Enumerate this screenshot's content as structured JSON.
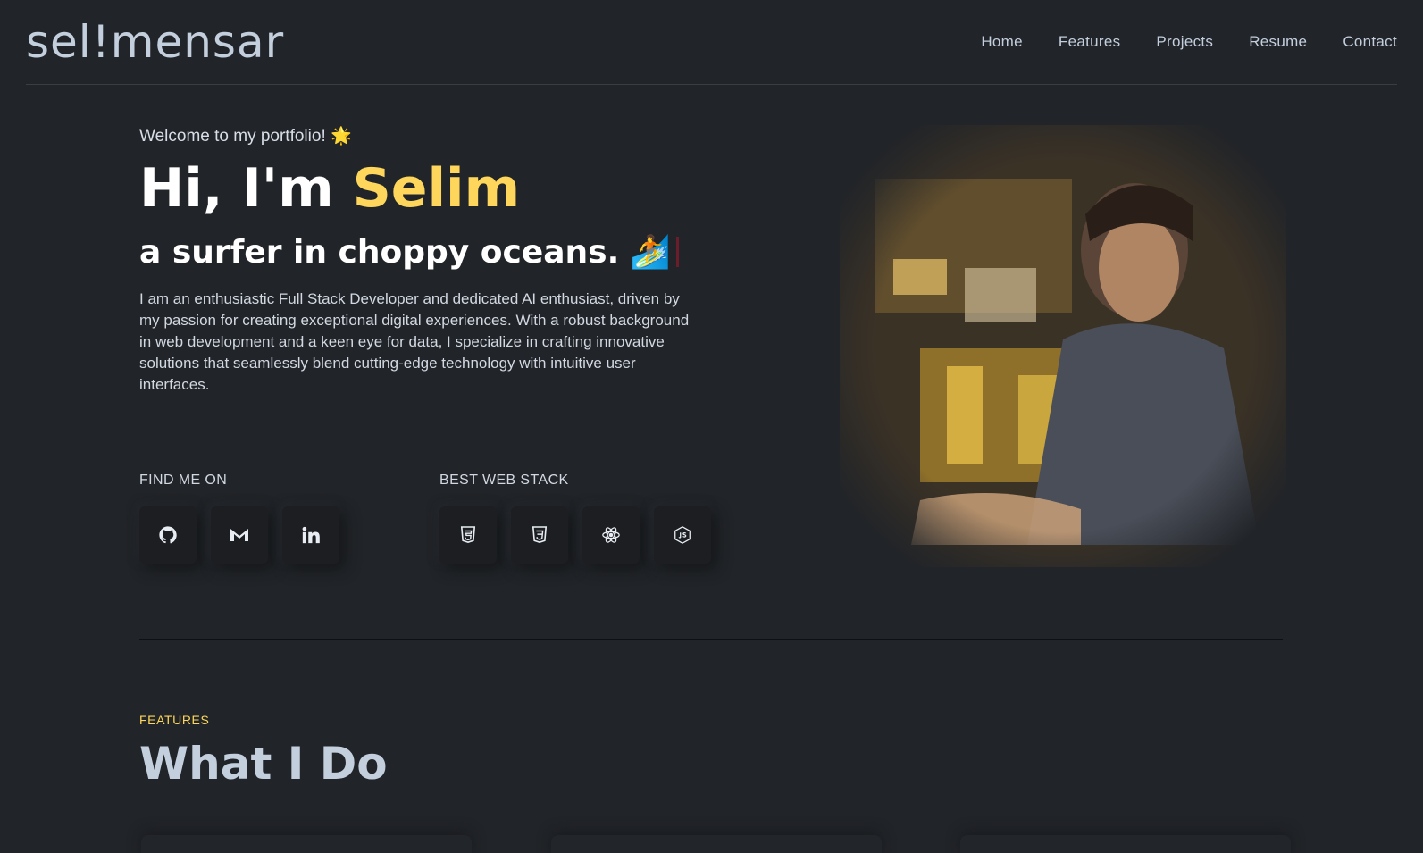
{
  "header": {
    "logo": "sel!mensar",
    "nav": [
      "Home",
      "Features",
      "Projects",
      "Resume",
      "Contact"
    ]
  },
  "hero": {
    "welcome": "Welcome to my portfolio! 🌟",
    "greeting": "Hi, I'm ",
    "name": "Selim",
    "tagline": "a surfer in choppy oceans. 🏄",
    "bio": "I am an enthusiastic Full Stack Developer and dedicated AI enthusiast, driven by my passion for creating exceptional digital experiences. With a robust background in web development and a keen eye for data, I specialize in crafting innovative solutions that seamlessly blend cutting-edge technology with intuitive user interfaces."
  },
  "social": {
    "title": "FIND ME ON",
    "items": [
      "github-icon",
      "gmail-icon",
      "linkedin-icon"
    ]
  },
  "stack": {
    "title": "BEST WEB STACK",
    "items": [
      "html5-icon",
      "css3-icon",
      "react-icon",
      "nodejs-icon"
    ]
  },
  "features": {
    "label": "FEATURES",
    "title": "What I Do"
  },
  "colors": {
    "background": "#212428",
    "accent": "#fdd65b",
    "text": "#c4cfde"
  }
}
